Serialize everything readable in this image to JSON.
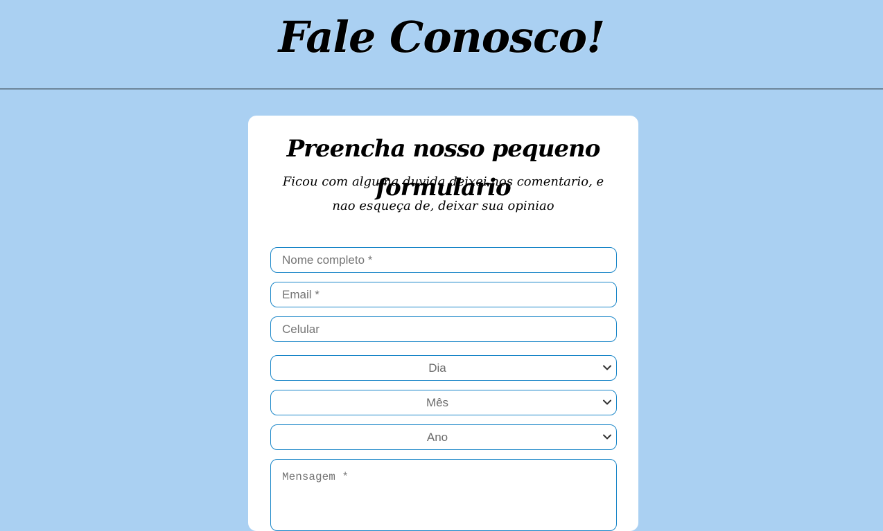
{
  "header": {
    "title": "Fale Conosco!"
  },
  "form": {
    "title": "Preencha nosso pequeno formulario",
    "subtitle": "Ficou com alguma duvida deixei nos comentario, e nao esqueça de, deixar sua opiniao",
    "fields": {
      "name_placeholder": "Nome completo *",
      "email_placeholder": "Email *",
      "phone_placeholder": "Celular",
      "message_placeholder": "Mensagem *"
    },
    "selects": {
      "day": "Dia",
      "month": "Mês",
      "year": "Ano"
    }
  },
  "icons": {
    "select_arrow": "chevron-down-icon"
  },
  "colors": {
    "background": "#aad0f2",
    "card": "#ffffff",
    "field_border": "#1a86c8",
    "divider": "#000000"
  }
}
